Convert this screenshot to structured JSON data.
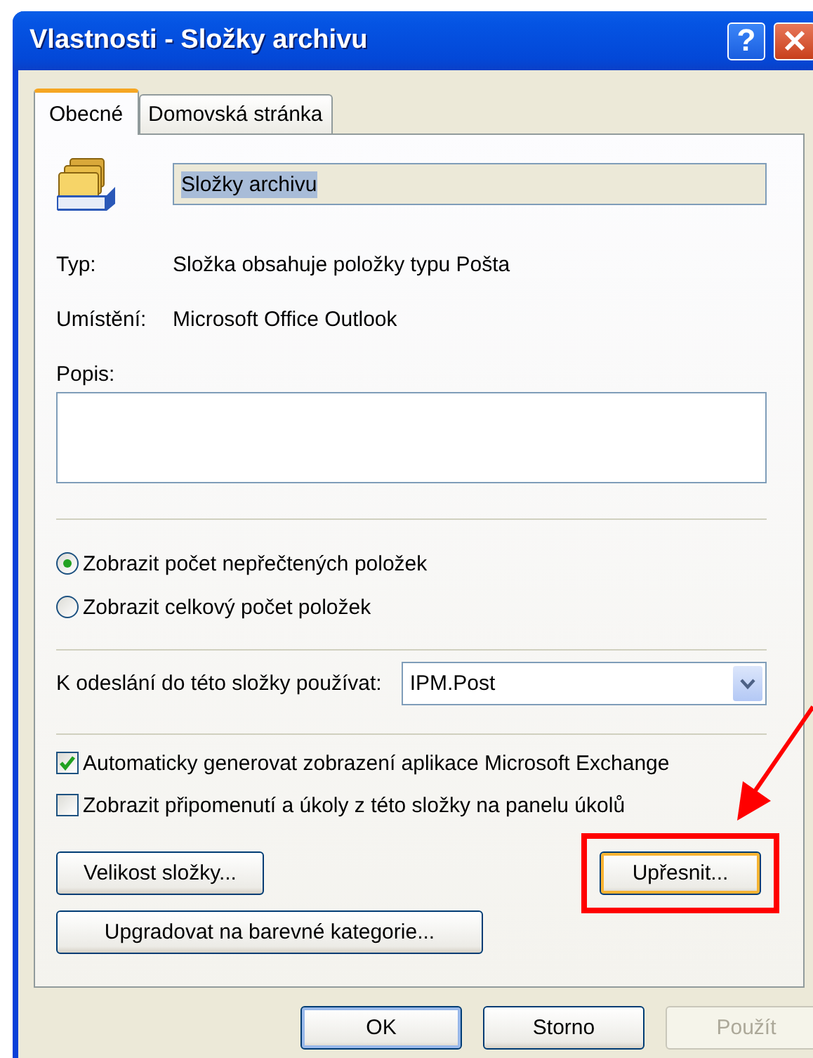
{
  "window": {
    "title": "Vlastnosti - Složky archivu",
    "help_button": "?"
  },
  "tabs": [
    {
      "label": "Obecné",
      "selected": true
    },
    {
      "label": "Domovská stránka",
      "selected": false
    }
  ],
  "folder": {
    "name": "Složky archivu",
    "name_selected": true
  },
  "properties": [
    {
      "label": "Typ:",
      "value": "Složka obsahuje položky typu Pošta"
    },
    {
      "label": "Umístění:",
      "value": "Microsoft Office Outlook"
    }
  ],
  "description": {
    "label": "Popis:"
  },
  "count_options": [
    {
      "label": "Zobrazit počet nepřečtených položek",
      "selected": true
    },
    {
      "label": "Zobrazit celkový počet položek",
      "selected": false
    }
  ],
  "post_form": {
    "label": "K odeslání do této složky používat:",
    "value": "IPM.Post"
  },
  "options": [
    {
      "label": "Automaticky generovat zobrazení aplikace Microsoft Exchange",
      "checked": true
    },
    {
      "label": "Zobrazit připomenutí a úkoly z této složky na panelu úkolů",
      "checked": false
    }
  ],
  "folder_size_button": {
    "label": "Velikost složky..."
  },
  "advanced_button": {
    "label": "Upřesnit...",
    "focused": true,
    "highlighted": true
  },
  "upgrade_button": {
    "label": "Upgradovat na barevné kategorie..."
  },
  "dialog_buttons": [
    {
      "label": "OK",
      "default": true,
      "disabled": false
    },
    {
      "label": "Storno",
      "default": false,
      "disabled": false
    },
    {
      "label": "Použít",
      "default": false,
      "disabled": true
    }
  ]
}
